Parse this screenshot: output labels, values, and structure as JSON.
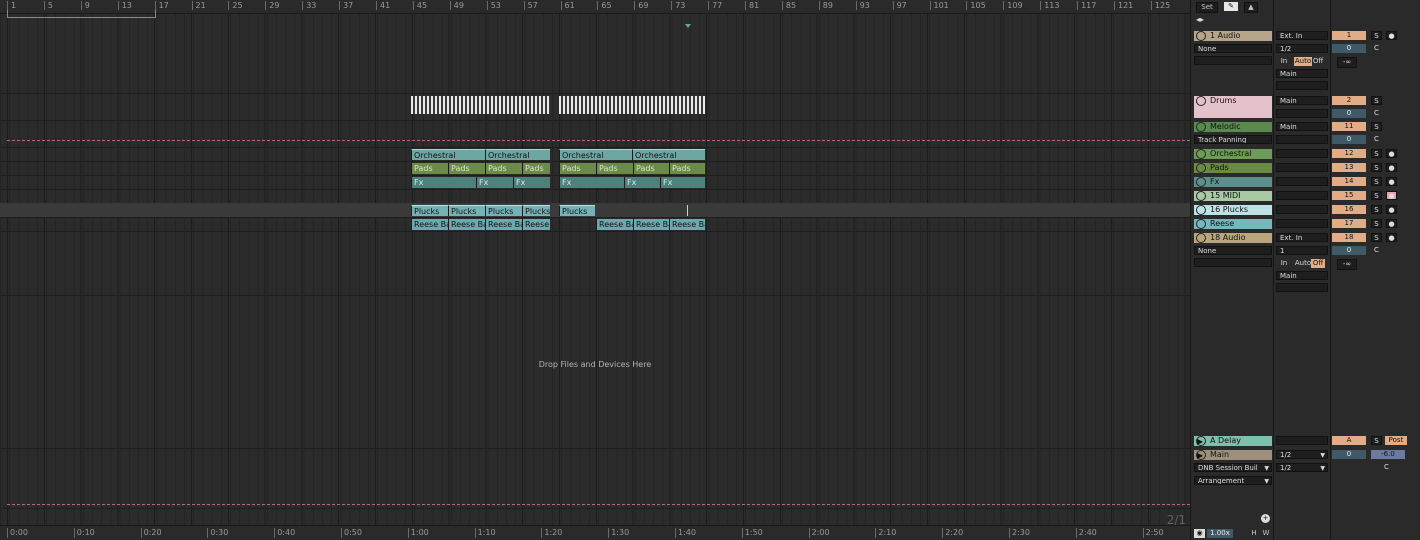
{
  "ruler": {
    "bars": [
      "1",
      "5",
      "9",
      "13",
      "17",
      "21",
      "25",
      "29",
      "33",
      "37",
      "41",
      "45",
      "49",
      "53",
      "57",
      "61",
      "65",
      "69",
      "73",
      "77",
      "81",
      "85",
      "89",
      "93",
      "97",
      "101",
      "105",
      "109",
      "113",
      "117",
      "121",
      "125"
    ]
  },
  "time_ruler": {
    "labels": [
      "0:00",
      "0:10",
      "0:20",
      "0:30",
      "0:40",
      "0:50",
      "1:00",
      "1:10",
      "1:20",
      "1:30",
      "1:40",
      "1:50",
      "2:00",
      "2:10",
      "2:20",
      "2:30",
      "2:40",
      "2:50"
    ]
  },
  "clips": {
    "orchestral": [
      "Orchestral",
      "Orchestral",
      "Orchestral",
      "Orchestral"
    ],
    "pads": [
      "Pads",
      "Pads",
      "Pads",
      "Pads",
      "Pads",
      "Pads",
      "Pads",
      "Pads"
    ],
    "fx": [
      "Fx",
      "Fx",
      "Fx",
      "Fx",
      "Fx",
      "Fx"
    ],
    "plucks": [
      "Plucks",
      "Plucks",
      "Plucks",
      "Plucks",
      "Plucks"
    ],
    "reese": [
      "Reese Bas",
      "Reese Bas",
      "Reese Bas",
      "Reese B",
      "Reese Bas",
      "Reese Bas",
      "Reese Bas"
    ]
  },
  "drop_text": "Drop Files and Devices Here",
  "page_indicator": "2/1",
  "header": {
    "set_label": "Set"
  },
  "tracks": [
    {
      "name": "1 Audio",
      "color": "#b5a58a",
      "input": "Ext. In",
      "channel": "1/2",
      "sub": "None",
      "number": "1",
      "vol": "0",
      "pan": "C",
      "monitor": [
        "In",
        "Auto",
        "Off"
      ],
      "out": "Main",
      "db": "-∞"
    },
    {
      "name": "Drums",
      "color": "#e3c2cc",
      "out": "Main",
      "number": "2",
      "vol": "0",
      "pan": "C"
    },
    {
      "name": "Melodic",
      "color": "#5b8a4f",
      "out": "Main",
      "number": "11",
      "vol": "0",
      "pan": "C",
      "sub": "Track Panning"
    },
    {
      "name": "Orchestral",
      "color": "#6d9c58",
      "number": "12"
    },
    {
      "name": "Pads",
      "color": "#6a8a44",
      "number": "13"
    },
    {
      "name": "Fx",
      "color": "#5c8f89",
      "number": "14"
    },
    {
      "name": "15 MIDI",
      "color": "#a9c8a4",
      "number": "15"
    },
    {
      "name": "16 Plucks",
      "color": "#bde3e7",
      "number": "16"
    },
    {
      "name": "Reese",
      "color": "#76b7bb",
      "number": "17"
    },
    {
      "name": "18 Audio",
      "color": "#b9a67d",
      "input": "Ext. In",
      "channel": "1",
      "sub": "None",
      "number": "18",
      "vol": "0",
      "pan": "C",
      "monitor": [
        "In",
        "Auto",
        "Off"
      ],
      "out": "Main",
      "db": "-∞"
    }
  ],
  "return": {
    "name": "A Delay",
    "color": "#7fbfae",
    "letter": "A",
    "post": "Post"
  },
  "main": {
    "name": "Main",
    "color": "#9e917c",
    "out1": "1/2",
    "out2": "1/2",
    "device": "DNB Session Buil",
    "mode": "Arrangement",
    "vol": "0",
    "db": "-6.0",
    "pan": "C"
  },
  "footer": {
    "zoom": "1.00x",
    "h": "H",
    "w": "W"
  },
  "labels": {
    "solo": "S",
    "center": "C"
  }
}
